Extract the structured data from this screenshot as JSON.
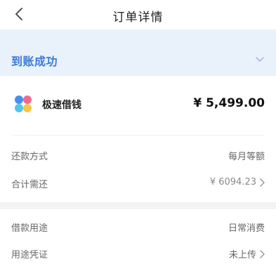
{
  "nav": {
    "title": "订单详情"
  },
  "status": {
    "label": "到账成功"
  },
  "product": {
    "name": "极速借钱",
    "amount": "¥ 5,499.00"
  },
  "section1": {
    "rows": [
      {
        "key": "还款方式",
        "value": "每月等额"
      },
      {
        "key": "合计需还",
        "value": "¥ 6094.23"
      }
    ]
  },
  "section2": {
    "rows": [
      {
        "key": "借款用途",
        "value": "日常消费"
      },
      {
        "key": "用途凭证",
        "value": "未上传"
      }
    ]
  },
  "colors": {
    "accent": "#3b7bd8",
    "status_bg": "#e9f1fb",
    "page_bg": "#f2f3f5"
  }
}
